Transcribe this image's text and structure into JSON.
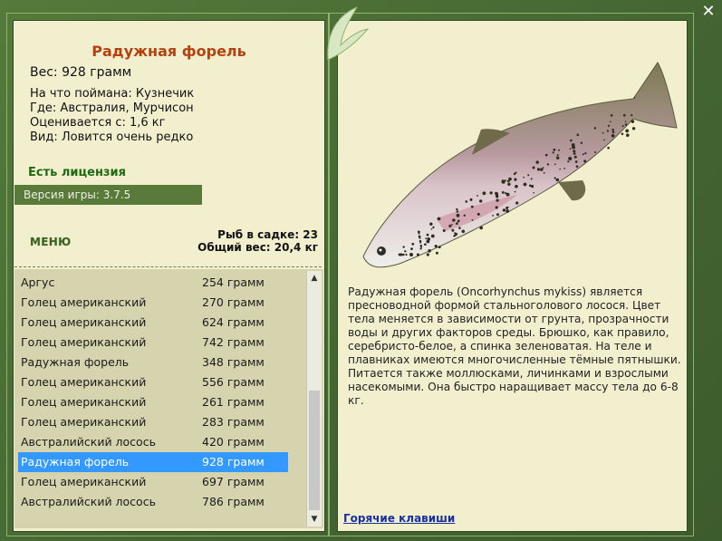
{
  "window": {
    "close_label": "x"
  },
  "fish": {
    "title": "Радужная форель",
    "weight": "Вес: 928 грамм",
    "bait": "На что поймана: Кузнечик",
    "place": "Где: Австралия, Мурчисон",
    "value": "Оценивается с: 1,6 кг",
    "rarity": "Вид: Ловится очень редко"
  },
  "license": "Есть лицензия",
  "version": "Версия игры: 3.7.5",
  "menu_label": "МЕНЮ",
  "keep": {
    "count": "Рыб в садке: 23",
    "total": "Общий вес: 20,4 кг"
  },
  "list": [
    {
      "name": "Аргус",
      "weight": "254 грамм"
    },
    {
      "name": "Голец американский",
      "weight": "270 грамм"
    },
    {
      "name": "Голец американский",
      "weight": "624 грамм"
    },
    {
      "name": "Голец американский",
      "weight": "742 грамм"
    },
    {
      "name": "Радужная форель",
      "weight": "348 грамм"
    },
    {
      "name": "Голец американский",
      "weight": "556 грамм"
    },
    {
      "name": "Голец американский",
      "weight": "261 грамм"
    },
    {
      "name": "Голец американский",
      "weight": "283 грамм"
    },
    {
      "name": "Австралийский лосось",
      "weight": "420 грамм"
    },
    {
      "name": "Радужная форель",
      "weight": "928 грамм"
    },
    {
      "name": "Голец американский",
      "weight": "697 грамм"
    },
    {
      "name": "Австралийский лосось",
      "weight": "786 грамм"
    }
  ],
  "selected_index": 9,
  "description": "Радужная форель (Oncorhynchus mykiss) является пресноводной формой стальноголового лосося. Цвет тела меняется в зависимости от грунта, прозрачности воды и других факторов среды. Брюшко, как правило, серебристо-белое, а спинка зеленоватая. На теле и плавниках имеются многочисленные тёмные пятнышки. Питается также моллюсками, личинками и взрослыми насекомыми. Она быстро наращивает массу тела до 6-8 кг.",
  "hotkeys_label": "Горячие клавиши",
  "icons": {
    "close": "close-icon",
    "leaf": "leaf-ornament-icon",
    "fish": "rainbow-trout-image"
  }
}
